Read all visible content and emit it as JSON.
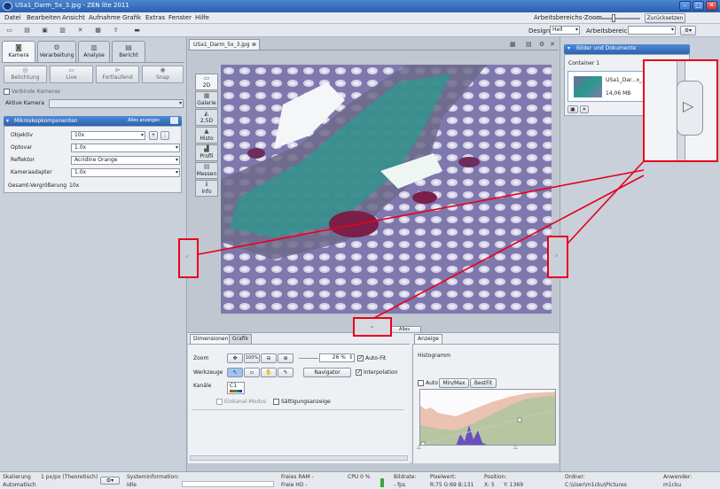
{
  "window": {
    "title": "USa1_Darm_5x_3.jpg - ZEN lite 2011"
  },
  "menu": [
    "Datei",
    "Bearbeiten",
    "Ansicht",
    "Aufnahme",
    "Grafik",
    "Extras",
    "Fenster",
    "Hilfe"
  ],
  "workspace": {
    "zoom_label": "Arbeitsbereichs-Zoom",
    "reset": "Zurücksetzen",
    "design_label": "Design",
    "design_value": "Hell",
    "area_label": "Arbeitsbereich"
  },
  "left": {
    "tabs": [
      "Kamera",
      "Verarbeitung",
      "Analyse",
      "Bericht"
    ],
    "modes": [
      "Belichtung",
      "Live",
      "Fortlaufend",
      "Snap"
    ],
    "connect_cameras": "Verbinde Kameras",
    "active_camera_label": "Aktive Kamera",
    "components_title": "Mikroskopkomponenten",
    "show_all": "Alles anzeigen",
    "rows": [
      {
        "label": "Objektiv",
        "value": "10x"
      },
      {
        "label": "Optovar",
        "value": "1.0x"
      },
      {
        "label": "Reflektor",
        "value": "Acridine Orange"
      },
      {
        "label": "Kameraadapter",
        "value": "1.0x"
      },
      {
        "label": "Gesamt-Vergrößerung",
        "value": "10x"
      }
    ]
  },
  "document": {
    "tab": "USa1_Darm_5x_3.jpg"
  },
  "view_tabs": [
    "2D",
    "Galerie",
    "2,5D",
    "Histo",
    "Profil",
    "Messen",
    "Info"
  ],
  "image_label": "Alles anzeigen",
  "bottom": {
    "tabs": [
      "Dimensionen",
      "Grafik"
    ],
    "zoom_label": "Zoom",
    "zoom_100": "100%",
    "zoom_value": "26 %",
    "autofit": "Auto-Fit",
    "tools_label": "Werkzeuge",
    "navigator": "Navigator",
    "interpolation": "Interpolation",
    "channels_label": "Kanäle",
    "channel": "C1",
    "single_channel": "Einkanal-Modus",
    "saturation": "Sättigungsanzeige"
  },
  "display": {
    "tab": "Anzeige",
    "histogram": "Histogramm",
    "auto": "Auto",
    "minmax": "Min/Max",
    "bestfit": "BestFit"
  },
  "right": {
    "title": "Bilder und Dokumente",
    "container": "Container 1",
    "thumb_name": "USa1_Dar...x_3",
    "thumb_size": "14,06 MB"
  },
  "status": {
    "scaling_label": "Skalierung",
    "scaling_value": "1 px/px (Theoretisch)",
    "auto": "Automatisch",
    "sysinfo_label": "Systeminformation:",
    "sysinfo_value": "Idle",
    "ram": "Freies RAM -",
    "hd": "Freie HD -",
    "cpu": "CPU 0 %",
    "fps_label": "Bildrate:",
    "fps_value": "- fps",
    "pixel_label": "Pixelwert:",
    "pixel_value": "R:75 G:69 B:131",
    "pos_label": "Position:",
    "pos_x": "X: 5",
    "pos_y": "Y: 1369",
    "folder_label": "Ordner:",
    "folder_value": "C:\\User\\m1cku\\Pictures",
    "user_label": "Anwender:",
    "user_value": "m1cku"
  }
}
